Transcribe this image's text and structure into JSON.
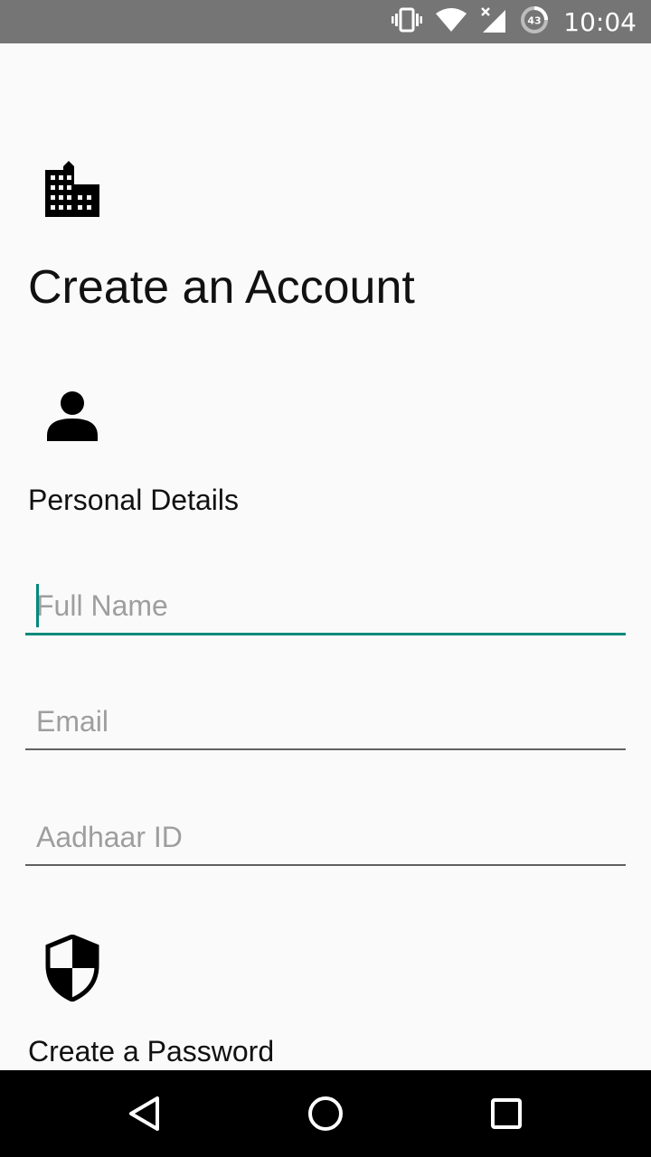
{
  "status_bar": {
    "time": "10:04",
    "battery_level": "43",
    "icons": [
      "vibrate-icon",
      "wifi-icon",
      "cellular-no-data-icon",
      "battery-saver-icon"
    ]
  },
  "header": {
    "icon": "building-icon",
    "title": "Create an Account"
  },
  "personal_details": {
    "icon": "person-icon",
    "title": "Personal Details",
    "fields": {
      "full_name": {
        "placeholder": "Full Name",
        "value": ""
      },
      "email": {
        "placeholder": "Email",
        "value": ""
      },
      "aadhaar": {
        "placeholder": "Aadhaar ID",
        "value": ""
      }
    }
  },
  "password_section": {
    "icon": "security-shield-icon",
    "title": "Create a Password"
  },
  "nav_bar": {
    "buttons": [
      "back-icon",
      "home-icon",
      "recents-icon"
    ]
  },
  "colors": {
    "accent": "#00897b",
    "status_bar": "#757575",
    "background": "#fafafa"
  }
}
